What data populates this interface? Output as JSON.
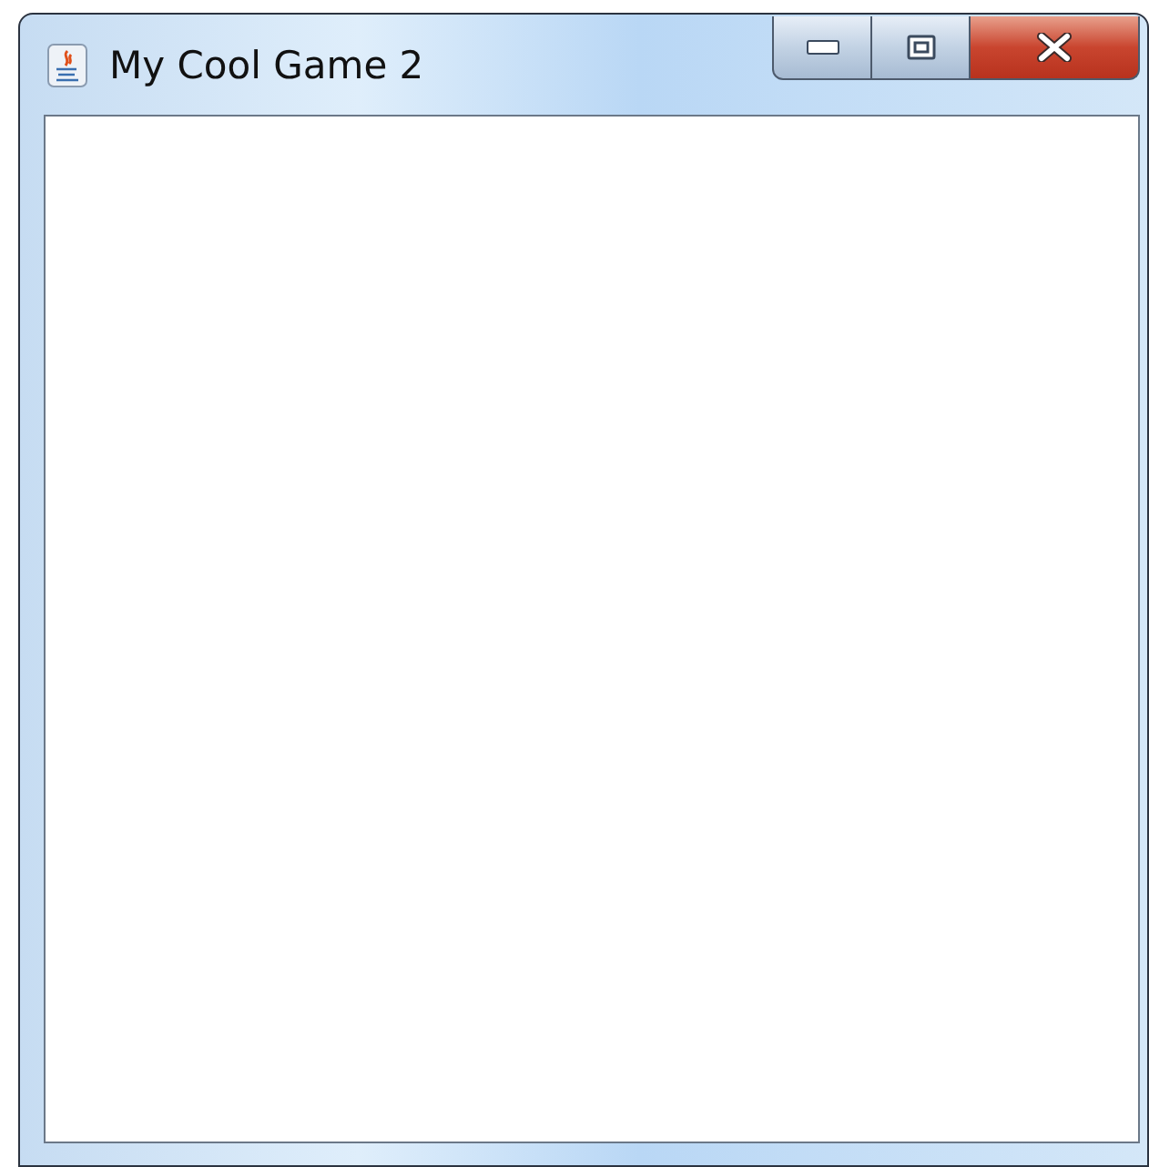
{
  "window": {
    "title": "My Cool Game 2"
  }
}
